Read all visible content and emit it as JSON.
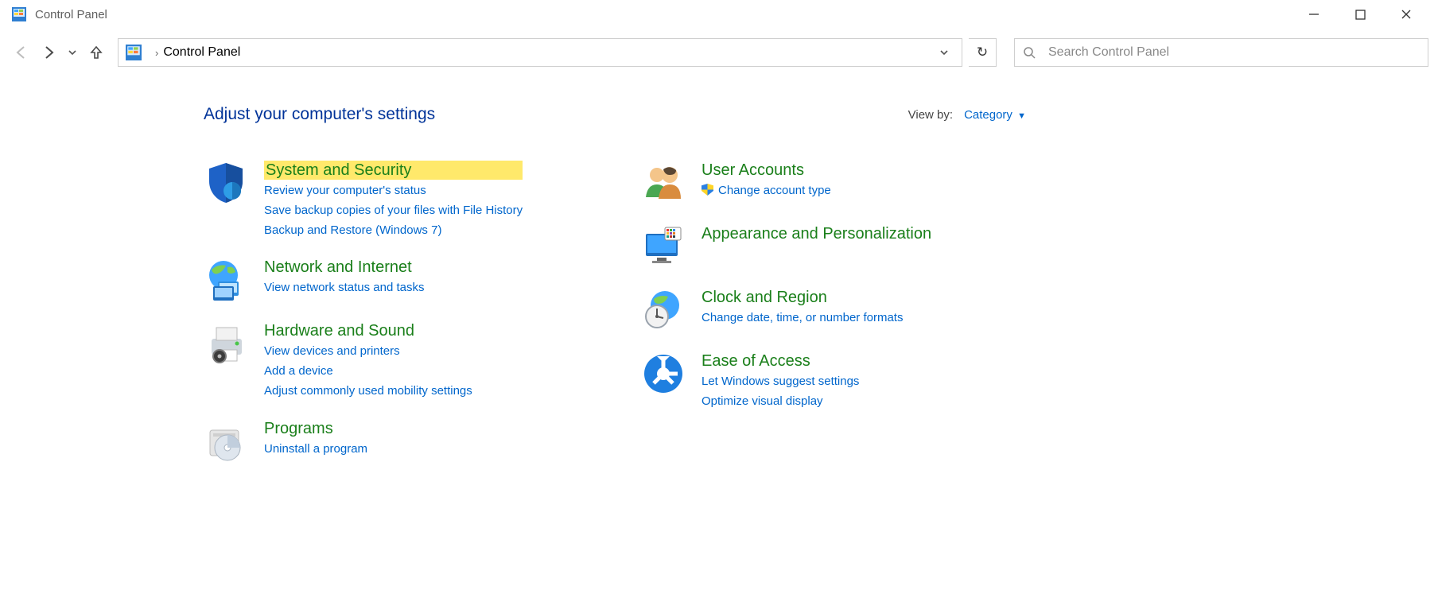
{
  "window": {
    "title": "Control Panel"
  },
  "address": {
    "location": "Control Panel"
  },
  "search": {
    "placeholder": "Search Control Panel"
  },
  "header": {
    "heading": "Adjust your computer's settings",
    "viewby_label": "View by:",
    "viewby_value": "Category"
  },
  "categories": {
    "left": [
      {
        "icon": "shield",
        "title": "System and Security",
        "highlight": true,
        "links": [
          "Review your computer's status",
          "Save backup copies of your files with File History",
          "Backup and Restore (Windows 7)"
        ]
      },
      {
        "icon": "globe",
        "title": "Network and Internet",
        "links": [
          "View network status and tasks"
        ]
      },
      {
        "icon": "printer",
        "title": "Hardware and Sound",
        "links": [
          "View devices and printers",
          "Add a device",
          "Adjust commonly used mobility settings"
        ]
      },
      {
        "icon": "disc",
        "title": "Programs",
        "links": [
          "Uninstall a program"
        ]
      }
    ],
    "right": [
      {
        "icon": "people",
        "title": "User Accounts",
        "links": [
          {
            "text": "Change account type",
            "shield": true
          }
        ]
      },
      {
        "icon": "monitor",
        "title": "Appearance and Personalization",
        "links": []
      },
      {
        "icon": "clock-globe",
        "title": "Clock and Region",
        "links": [
          "Change date, time, or number formats"
        ]
      },
      {
        "icon": "ease",
        "title": "Ease of Access",
        "links": [
          "Let Windows suggest settings",
          "Optimize visual display"
        ]
      }
    ]
  }
}
